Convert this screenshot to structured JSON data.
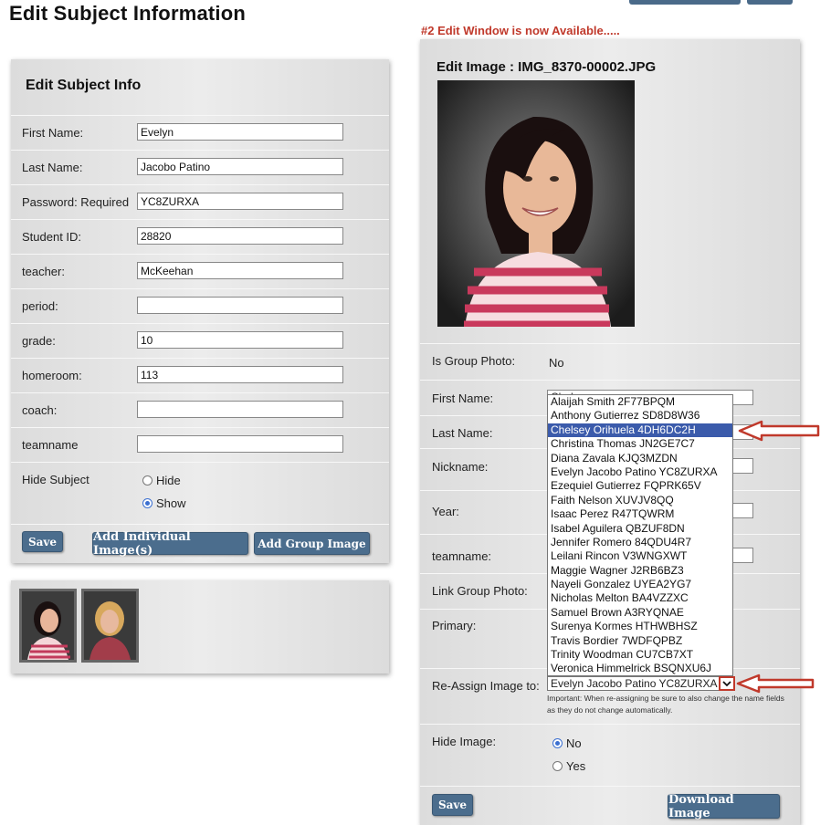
{
  "page": {
    "title": "Edit Subject Information",
    "notice": "#2 Edit Window is now Available....."
  },
  "left": {
    "heading": "Edit Subject Info",
    "fields": [
      {
        "label": "First Name:",
        "value": "Evelyn"
      },
      {
        "label": "Last Name:",
        "value": "Jacobo Patino"
      },
      {
        "label": "Password: Required",
        "value": "YC8ZURXA"
      },
      {
        "label": "Student ID:",
        "value": "28820"
      },
      {
        "label": "teacher:",
        "value": "McKeehan"
      },
      {
        "label": "period:",
        "value": ""
      },
      {
        "label": "grade:",
        "value": "10"
      },
      {
        "label": "homeroom:",
        "value": "113"
      },
      {
        "label": "coach:",
        "value": ""
      },
      {
        "label": "teamname",
        "value": ""
      }
    ],
    "hide_subject": {
      "label": "Hide Subject",
      "options": [
        "Hide",
        "Show"
      ],
      "selected": "Show"
    },
    "buttons": {
      "save": "Save",
      "add_individual": "Add Individual Image(s)",
      "add_group": "Add Group Image"
    }
  },
  "right": {
    "heading": "Edit Image : IMG_8370-00002.JPG",
    "is_group_photo": {
      "label": "Is Group Photo:",
      "value": "No"
    },
    "first_name_label": "First Name:",
    "first_name_value_partial": "Chelsey",
    "last_name_label": "Last Name:",
    "nickname_label": "Nickname:",
    "year_label": "Year:",
    "teamname_label": "teamname:",
    "link_group_label": "Link Group Photo:",
    "primary_label": "Primary:",
    "reassign_label": "Re-Assign Image to:",
    "reassign_selected": "Evelyn Jacobo Patino YC8ZURXA",
    "reassign_note": "Important: When re-assigning be sure to also change the name fields as they do not change automatically.",
    "hide_image": {
      "label": "Hide Image:",
      "options": [
        "No",
        "Yes"
      ],
      "selected": "No"
    },
    "buttons": {
      "save": "Save",
      "download": "Download Image"
    }
  },
  "dropdown": {
    "selected_index": 2,
    "options": [
      "Alaijah Smith 2F77BPQM",
      "Anthony Gutierrez SD8D8W36",
      "Chelsey Orihuela 4DH6DC2H",
      "Christina Thomas JN2GE7C7",
      "Diana Zavala KJQ3MZDN",
      "Evelyn Jacobo Patino YC8ZURXA",
      "Ezequiel Gutierrez FQPRK65V",
      "Faith Nelson XUVJV8QQ",
      "Isaac Perez R47TQWRM",
      "Isabel Aguilera QBZUF8DN",
      "Jennifer Romero 84QDU4R7",
      "Leilani Rincon V3WNGXWT",
      "Maggie Wagner J2RB6BZ3",
      "Nayeli Gonzalez UYEA2YG7",
      "Nicholas Melton BA4VZZXC",
      "Samuel Brown A3RYQNAE",
      "Surenya Kormes HTHWBHSZ",
      "Travis Bordier 7WDFQPBZ",
      "Trinity Woodman CU7CB7XT",
      "Veronica Himmelrick BSQNXU6J"
    ]
  },
  "colors": {
    "accent": "#4b6d8d",
    "notice": "#c0392b",
    "annotation": "#c0392b",
    "selection": "#3b5bab"
  }
}
